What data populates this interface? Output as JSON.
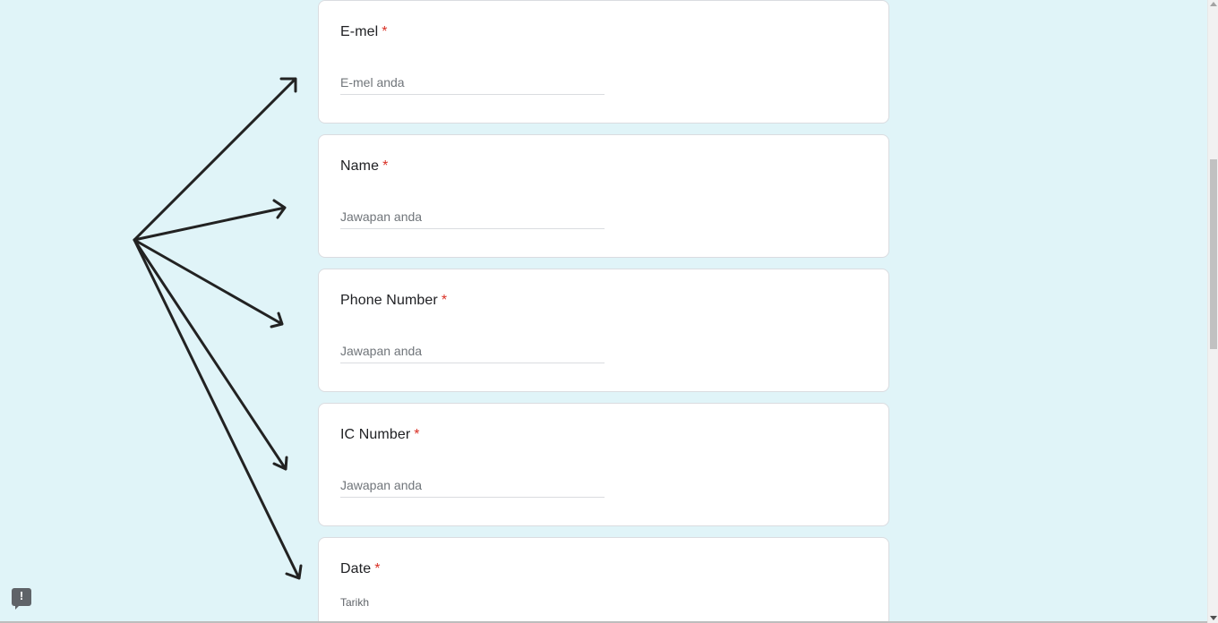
{
  "form": {
    "questions": [
      {
        "title": "E-mel",
        "required_mark": "*",
        "placeholder": "E-mel anda"
      },
      {
        "title": "Name",
        "required_mark": "*",
        "placeholder": "Jawapan anda"
      },
      {
        "title": "Phone Number",
        "required_mark": "*",
        "placeholder": "Jawapan anda"
      },
      {
        "title": "IC Number",
        "required_mark": "*",
        "placeholder": "Jawapan anda"
      },
      {
        "title": "Date",
        "required_mark": "*",
        "sub_label": "Tarikh"
      }
    ]
  },
  "colors": {
    "background": "#e0f4f8",
    "required": "#d93025",
    "card": "#ffffff"
  },
  "icons": {
    "report": "report-problem-icon"
  }
}
